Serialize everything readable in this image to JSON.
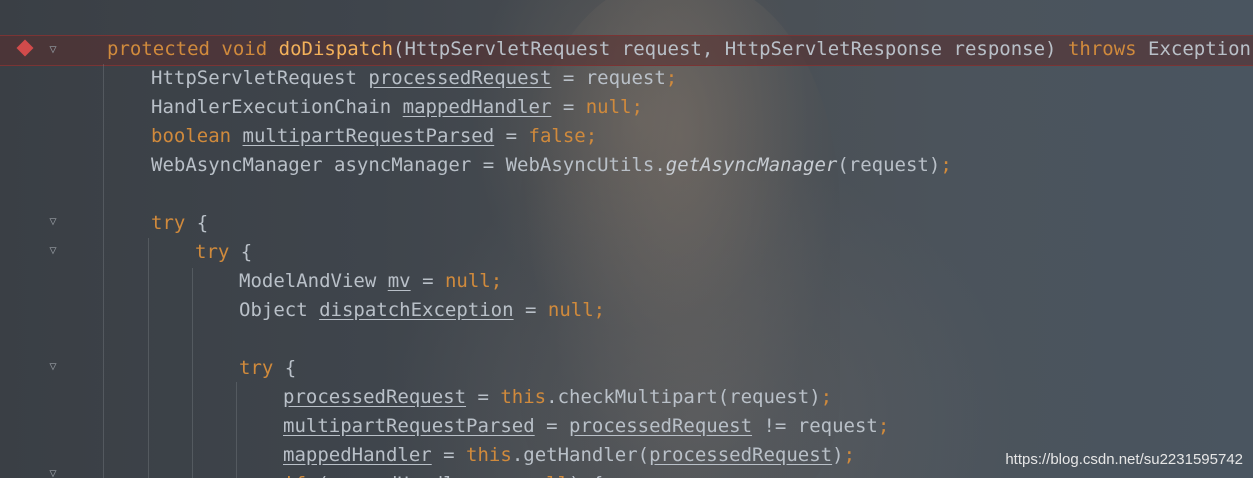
{
  "colors": {
    "keyword": "#d08a3c",
    "function_name": "#f3b15a",
    "plain_text": "#b9c0c8",
    "breakpoint": "#d14b4b",
    "highlight_line": "#5a2d2d"
  },
  "icons": {
    "breakpoint": "breakpoint-diamond-icon",
    "fold": "fold-arrow-icon"
  },
  "code": {
    "line1": {
      "kw_protected": "protected",
      "kw_void": "void",
      "method": "doDispatch",
      "params": "(HttpServletRequest request, HttpServletResponse response)",
      "kw_throws": "throws",
      "tail": "Exception {"
    },
    "line2": {
      "type": "HttpServletRequest",
      "var": "processedRequest",
      "rest": " = request",
      "semi": ";"
    },
    "line3": {
      "type": "HandlerExecutionChain",
      "var": "mappedHandler",
      "eq": " = ",
      "value": "null",
      "semi": ";"
    },
    "line4": {
      "kw": "boolean",
      "var": "multipartRequestParsed",
      "eq": " = ",
      "value": "false",
      "semi": ";"
    },
    "line5": {
      "prefix": "WebAsyncManager asyncManager = WebAsyncUtils.",
      "method": "getAsyncManager",
      "args": "(request)",
      "semi": ";"
    },
    "line7": {
      "kw": "try",
      "brace": " {"
    },
    "line8": {
      "kw": "try",
      "brace": " {"
    },
    "line9": {
      "type": "ModelAndView",
      "var": "mv",
      "eq": " = ",
      "value": "null",
      "semi": ";"
    },
    "line10": {
      "type": "Object",
      "var": "dispatchException",
      "eq": " = ",
      "value": "null",
      "semi": ";"
    },
    "line12": {
      "kw": "try",
      "brace": " {"
    },
    "line13": {
      "var": "processedRequest",
      "eq": " = ",
      "kw_this": "this",
      "call": ".checkMultipart(request)",
      "semi": ";"
    },
    "line14": {
      "var": "multipartRequestParsed",
      "eq": " = ",
      "var2": "processedRequest",
      "rest": " != request",
      "semi": ";"
    },
    "line15": {
      "var": "mappedHandler",
      "eq": " = ",
      "kw_this": "this",
      "call": ".getHandler(",
      "var2": "processedRequest",
      "close": ")",
      "semi": ";"
    },
    "line16": {
      "kw": "if",
      "open": " (",
      "var": "mappedHandler",
      "op": " == ",
      "value": "null",
      "tail": ") {"
    }
  },
  "watermark": "https://blog.csdn.net/su2231595742"
}
